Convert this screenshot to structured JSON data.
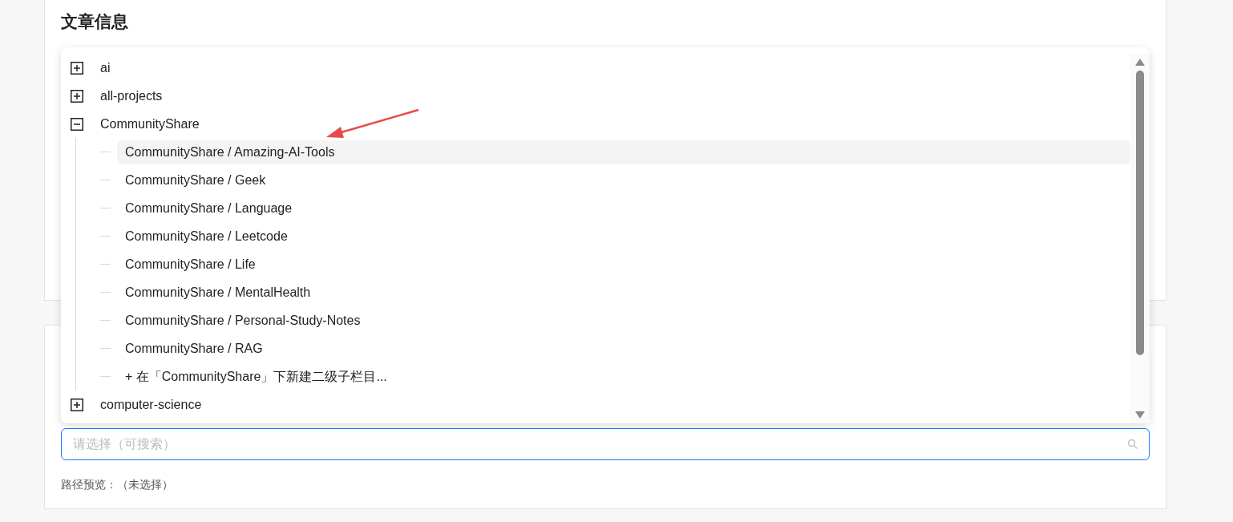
{
  "section_title": "文章信息",
  "tree": [
    {
      "label": "ai",
      "expanded": false
    },
    {
      "label": "all-projects",
      "expanded": false
    },
    {
      "label": "CommunityShare",
      "expanded": true,
      "children": [
        {
          "label": "CommunityShare / Amazing-AI-Tools",
          "selected": true
        },
        {
          "label": "CommunityShare / Geek",
          "selected": false
        },
        {
          "label": "CommunityShare / Language",
          "selected": false
        },
        {
          "label": "CommunityShare / Leetcode",
          "selected": false
        },
        {
          "label": "CommunityShare / Life",
          "selected": false
        },
        {
          "label": "CommunityShare / MentalHealth",
          "selected": false
        },
        {
          "label": "CommunityShare / Personal-Study-Notes",
          "selected": false
        },
        {
          "label": "CommunityShare / RAG",
          "selected": false
        },
        {
          "label": "+ 在「CommunityShare」下新建二级子栏目...",
          "selected": false
        }
      ]
    },
    {
      "label": "computer-science",
      "expanded": false
    }
  ],
  "search": {
    "placeholder": "请选择（可搜索）"
  },
  "path_preview": {
    "label": "路径预览：",
    "value": "（未选择）"
  }
}
